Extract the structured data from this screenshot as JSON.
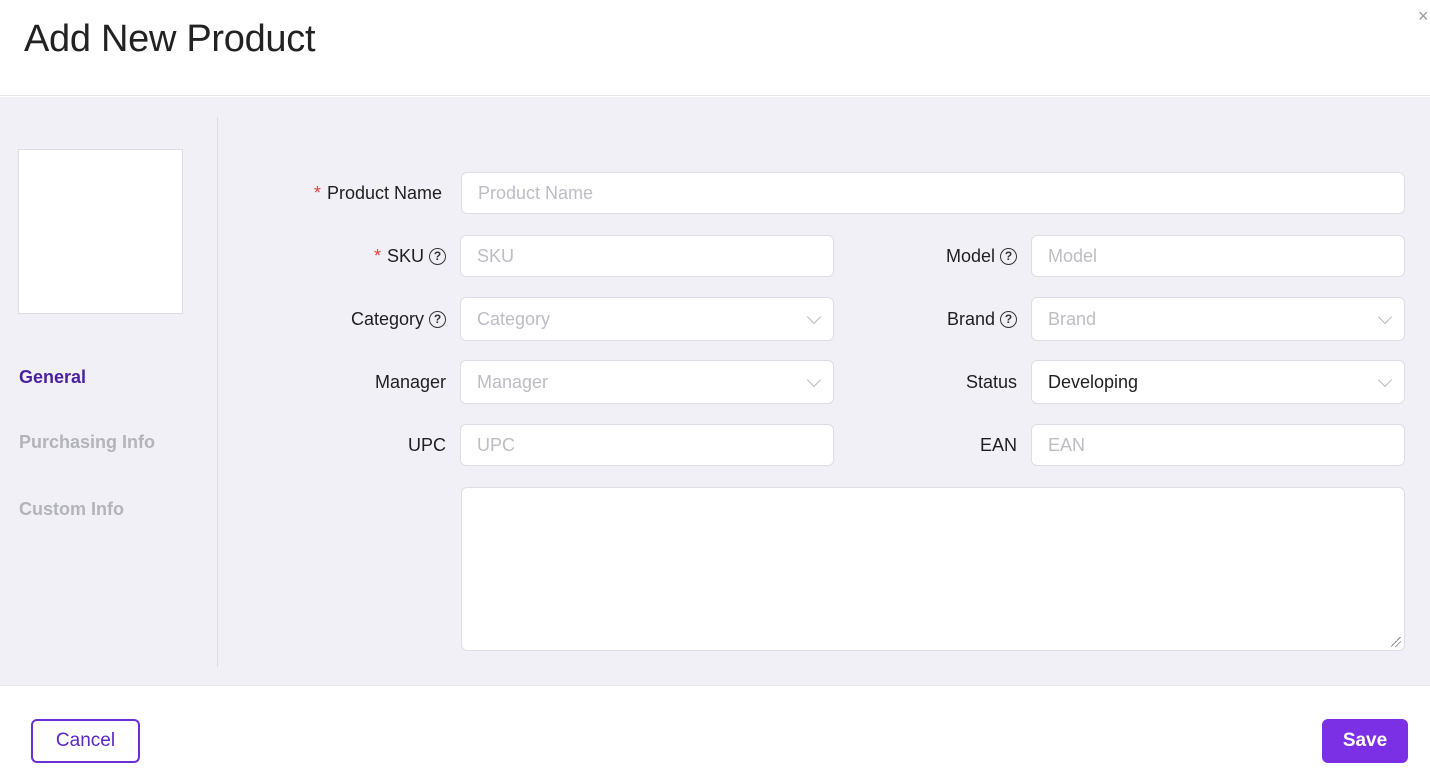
{
  "header": {
    "title": "Add New Product",
    "close_glyph": "×"
  },
  "sidebar": {
    "nav": [
      {
        "label": "General",
        "active": true
      },
      {
        "label": "Purchasing Info",
        "active": false
      },
      {
        "label": "Custom Info",
        "active": false
      }
    ]
  },
  "form": {
    "product_name": {
      "label": "Product Name",
      "required": "*",
      "placeholder": "Product Name",
      "value": ""
    },
    "sku": {
      "label": "SKU",
      "required": "*",
      "placeholder": "SKU",
      "value": ""
    },
    "model": {
      "label": "Model",
      "placeholder": "Model",
      "value": ""
    },
    "category": {
      "label": "Category",
      "placeholder": "Category",
      "value": ""
    },
    "brand": {
      "label": "Brand",
      "placeholder": "Brand",
      "value": ""
    },
    "manager": {
      "label": "Manager",
      "placeholder": "Manager",
      "value": ""
    },
    "status": {
      "label": "Status",
      "value": "Developing"
    },
    "upc": {
      "label": "UPC",
      "placeholder": "UPC",
      "value": ""
    },
    "ean": {
      "label": "EAN",
      "placeholder": "EAN",
      "value": ""
    },
    "description": {
      "value": ""
    },
    "help_glyph": "?"
  },
  "footer": {
    "cancel_label": "Cancel",
    "save_label": "Save"
  },
  "colors": {
    "accent": "#7c30e6",
    "nav_active": "#4b1f9e",
    "required": "#e3453a",
    "body_bg": "#f1f0f7"
  },
  "icons": {
    "close": "close-icon",
    "help": "help-circle-icon",
    "dropdown": "chevron-down-icon",
    "resize": "resize-handle-icon"
  }
}
